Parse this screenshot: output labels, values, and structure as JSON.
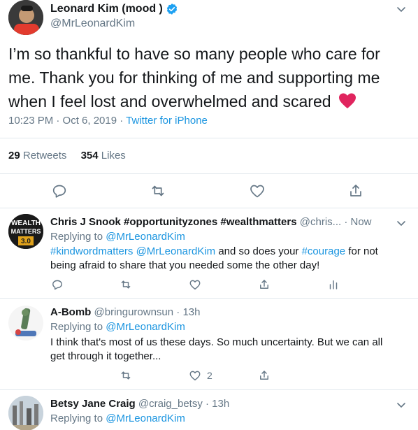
{
  "main_tweet": {
    "display_name": "Leonard Kim (mood )",
    "handle": "@MrLeonardKim",
    "text": "I’m so thankful to have so many people who care for me. Thank you for thinking of me and supporting me when I feel lost and overwhelmed and scared",
    "emoji": "❤",
    "time": "10:23 PM · Oct 6, 2019",
    "separator": " · ",
    "source": "Twitter for iPhone",
    "retweets_count": "29",
    "retweets_label": "Retweets",
    "likes_count": "354",
    "likes_label": "Likes"
  },
  "replies": [
    {
      "display_name": "Chris J Snook #opportunityzones #wealthmatters",
      "handle": "@chris...",
      "time": "· Now",
      "replying_label": "Replying to",
      "replying_to": "@MrLeonardKim",
      "avatar_text_1": "WEALTH",
      "avatar_text_2": "MATTERS",
      "avatar_text_3": "3.0",
      "body": {
        "hashtag1": "#kindwordmatters",
        "mention": "@MrLeonardKim",
        "text1": " and so does your ",
        "hashtag2": "#courage",
        "text2": " for not being afraid to share that you needed some the other day!"
      }
    },
    {
      "display_name": "A-Bomb",
      "handle": "@bringurownsun",
      "time": "· 13h",
      "replying_label": "Replying to",
      "replying_to": "@MrLeonardKim",
      "body": "I think that's most of us these days. So much uncertainty. But we can all get through it together...",
      "like_count": "2"
    },
    {
      "display_name": "Betsy Jane Craig",
      "handle": "@craig_betsy",
      "time": "· 13h",
      "replying_label": "Replying to",
      "replying_to": "@MrLeonardKim"
    }
  ],
  "colors": {
    "link_blue": "#1b95e0",
    "muted_gray": "#657786",
    "divider": "#e1e8ed",
    "heart_red": "#e0245e",
    "verified_blue": "#1da1f2"
  }
}
